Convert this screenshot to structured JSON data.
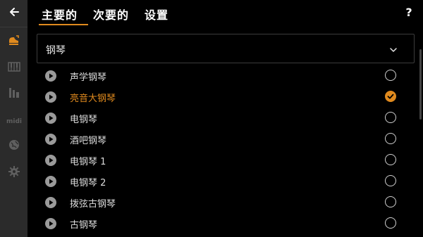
{
  "header": {
    "tabs": [
      {
        "label": "主要的",
        "active": true
      },
      {
        "label": "次要的",
        "active": false
      },
      {
        "label": "设置",
        "active": false
      }
    ],
    "help_label": "?"
  },
  "sidebar": {
    "items": [
      {
        "icon": "back-arrow-icon"
      },
      {
        "icon": "piano-icon",
        "active": true
      },
      {
        "icon": "keyboard-icon"
      },
      {
        "icon": "mixer-icon"
      },
      {
        "icon": "midi-icon"
      },
      {
        "icon": "globe-icon"
      },
      {
        "icon": "gear-icon"
      }
    ]
  },
  "dropdown": {
    "selected": "钢琴"
  },
  "instruments": [
    {
      "label": "声学钢琴",
      "selected": false
    },
    {
      "label": "亮音大钢琴",
      "selected": true
    },
    {
      "label": "电钢琴",
      "selected": false
    },
    {
      "label": "酒吧钢琴",
      "selected": false
    },
    {
      "label": "电钢琴 1",
      "selected": false
    },
    {
      "label": "电钢琴 2",
      "selected": false
    },
    {
      "label": "拨弦古钢琴",
      "selected": false
    },
    {
      "label": "古钢琴",
      "selected": false
    }
  ],
  "colors": {
    "accent": "#e08a1e",
    "sidebar_bg": "#2b2b2b",
    "background": "#000000"
  }
}
